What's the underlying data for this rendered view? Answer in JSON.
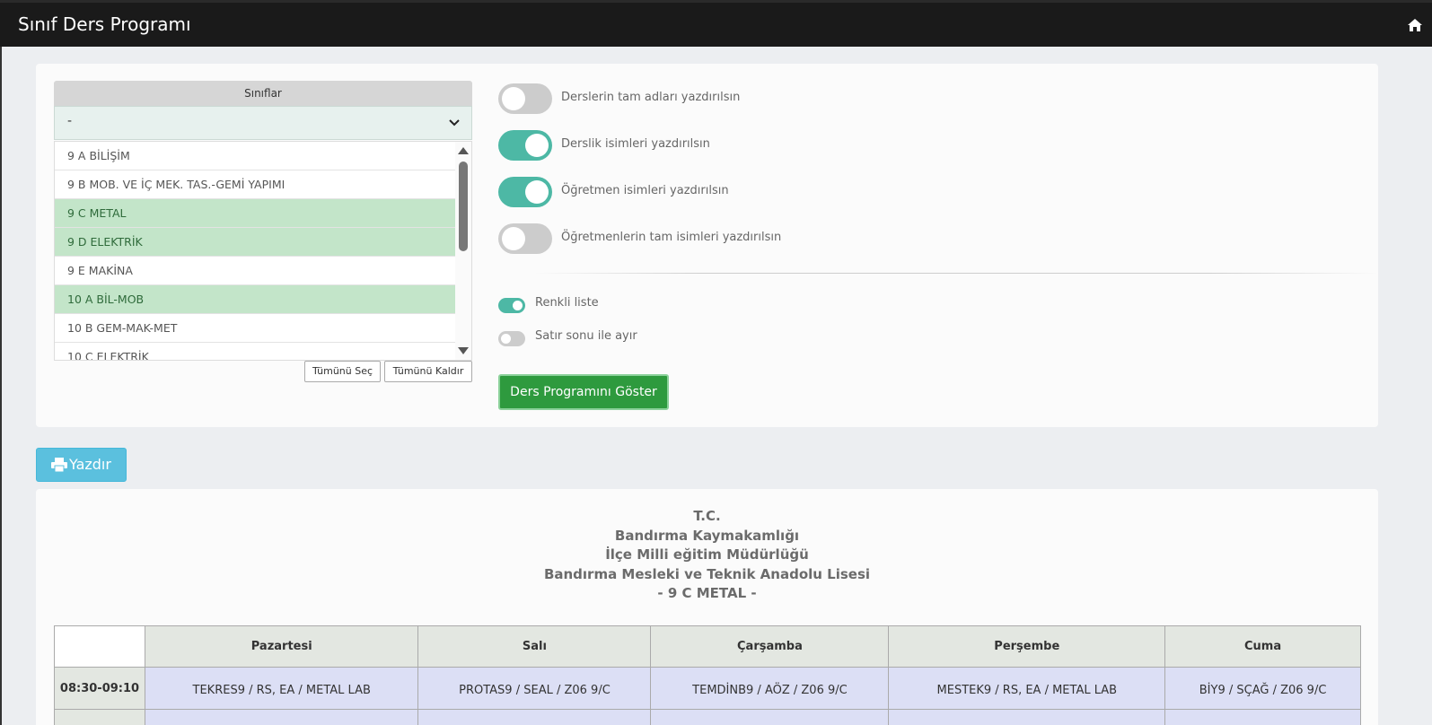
{
  "header": {
    "title": "Sınıf Ders Programı",
    "home_icon": "home-icon"
  },
  "classes": {
    "header": "Sınıflar",
    "selected_value": "-",
    "items": [
      {
        "label": "9 A BİLİŞİM",
        "selected": false
      },
      {
        "label": "9 B MOB. VE İÇ MEK. TAS.-GEMİ YAPIMI",
        "selected": false
      },
      {
        "label": "9 C METAL",
        "selected": true
      },
      {
        "label": "9 D ELEKTRİK",
        "selected": true
      },
      {
        "label": "9 E MAKİNA",
        "selected": false
      },
      {
        "label": "10 A BİL-MOB",
        "selected": true
      },
      {
        "label": "10 B GEM-MAK-MET",
        "selected": false
      },
      {
        "label": "10 C ELEKTRİK",
        "selected": false
      }
    ],
    "select_all": "Tümünü Seç",
    "deselect_all": "Tümünü Kaldır"
  },
  "options": {
    "toggles": [
      {
        "label": "Derslerin tam adları yazdırılsın",
        "on": false
      },
      {
        "label": "Derslik isimleri yazdırılsın",
        "on": true
      },
      {
        "label": "Öğretmen isimleri yazdırılsın",
        "on": true
      },
      {
        "label": "Öğretmenlerin tam isimleri yazdırılsın",
        "on": false
      }
    ],
    "mini_toggles": [
      {
        "label": "Renkli liste",
        "on": true
      },
      {
        "label": "Satır sonu ile ayır",
        "on": false
      }
    ],
    "show_button": "Ders Programını Göster"
  },
  "print_button": "Yazdır",
  "schedule": {
    "heading_lines": [
      "T.C.",
      "Bandırma Kaymakamlığı",
      "İlçe Milli eğitim Müdürlüğü",
      "Bandırma Mesleki ve Teknik Anadolu Lisesi",
      "- 9 C METAL -"
    ],
    "days": [
      "Pazartesi",
      "Salı",
      "Çarşamba",
      "Perşembe",
      "Cuma"
    ],
    "rows": [
      {
        "time": "08:30-09:10",
        "cells": [
          "TEKRES9 / RS, EA / METAL LAB",
          "PROTAS9 / SEAL / Z06 9/C",
          "TEMDİNB9 / AÖZ / Z06 9/C",
          "MESTEK9 / RS, EA / METAL LAB",
          "BİY9 / SÇAĞ / Z06 9/C"
        ]
      }
    ]
  },
  "colors": {
    "accent_toggle": "#4db8a5",
    "primary_button": "#2e9a3e",
    "print_button": "#5bc0de",
    "selected_row": "#c3e5c9",
    "schedule_cell": "#dcdff5"
  }
}
